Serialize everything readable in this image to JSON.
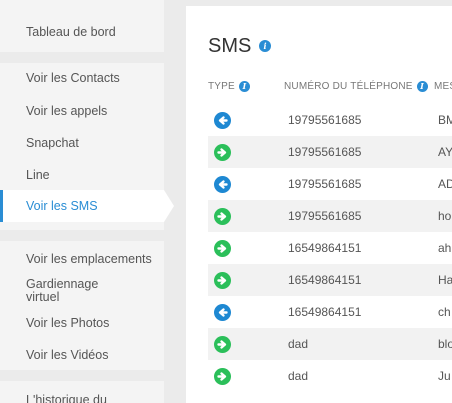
{
  "sidebar": {
    "items": [
      {
        "label": "Tableau de bord"
      },
      {
        "label": "Voir les Contacts"
      },
      {
        "label": "Voir les appels"
      },
      {
        "label": "Snapchat"
      },
      {
        "label": "Line"
      },
      {
        "label": "Voir les SMS"
      },
      {
        "label": "Voir les emplacements"
      },
      {
        "label": "Gardiennage virtuel"
      },
      {
        "label": "Voir les Photos"
      },
      {
        "label": "Voir les Vidéos"
      },
      {
        "label": "L'historique du"
      }
    ]
  },
  "main": {
    "title": "SMS",
    "columns": {
      "type": "TYPE",
      "phone": "NUMÉRO DU TÉLÉPHONE",
      "message": "MES"
    },
    "rows": [
      {
        "direction": "incoming",
        "number": "19795561685",
        "message": "BM"
      },
      {
        "direction": "outgoing",
        "number": "19795561685",
        "message": "AY"
      },
      {
        "direction": "incoming",
        "number": "19795561685",
        "message": "AD"
      },
      {
        "direction": "outgoing",
        "number": "19795561685",
        "message": "ho"
      },
      {
        "direction": "outgoing",
        "number": "16549864151",
        "message": "ah"
      },
      {
        "direction": "outgoing",
        "number": "16549864151",
        "message": "Ha"
      },
      {
        "direction": "incoming",
        "number": "16549864151",
        "message": "ch"
      },
      {
        "direction": "outgoing",
        "number": "dad",
        "message": "blo"
      },
      {
        "direction": "outgoing",
        "number": "dad",
        "message": "Ju"
      }
    ]
  },
  "colors": {
    "accent": "#2a8dd4",
    "incoming": "#1e88d2",
    "outgoing": "#2bbf5a"
  },
  "icons": {
    "incoming": "arrow-left-circle-icon",
    "outgoing": "arrow-right-circle-icon",
    "info": "info-icon"
  }
}
